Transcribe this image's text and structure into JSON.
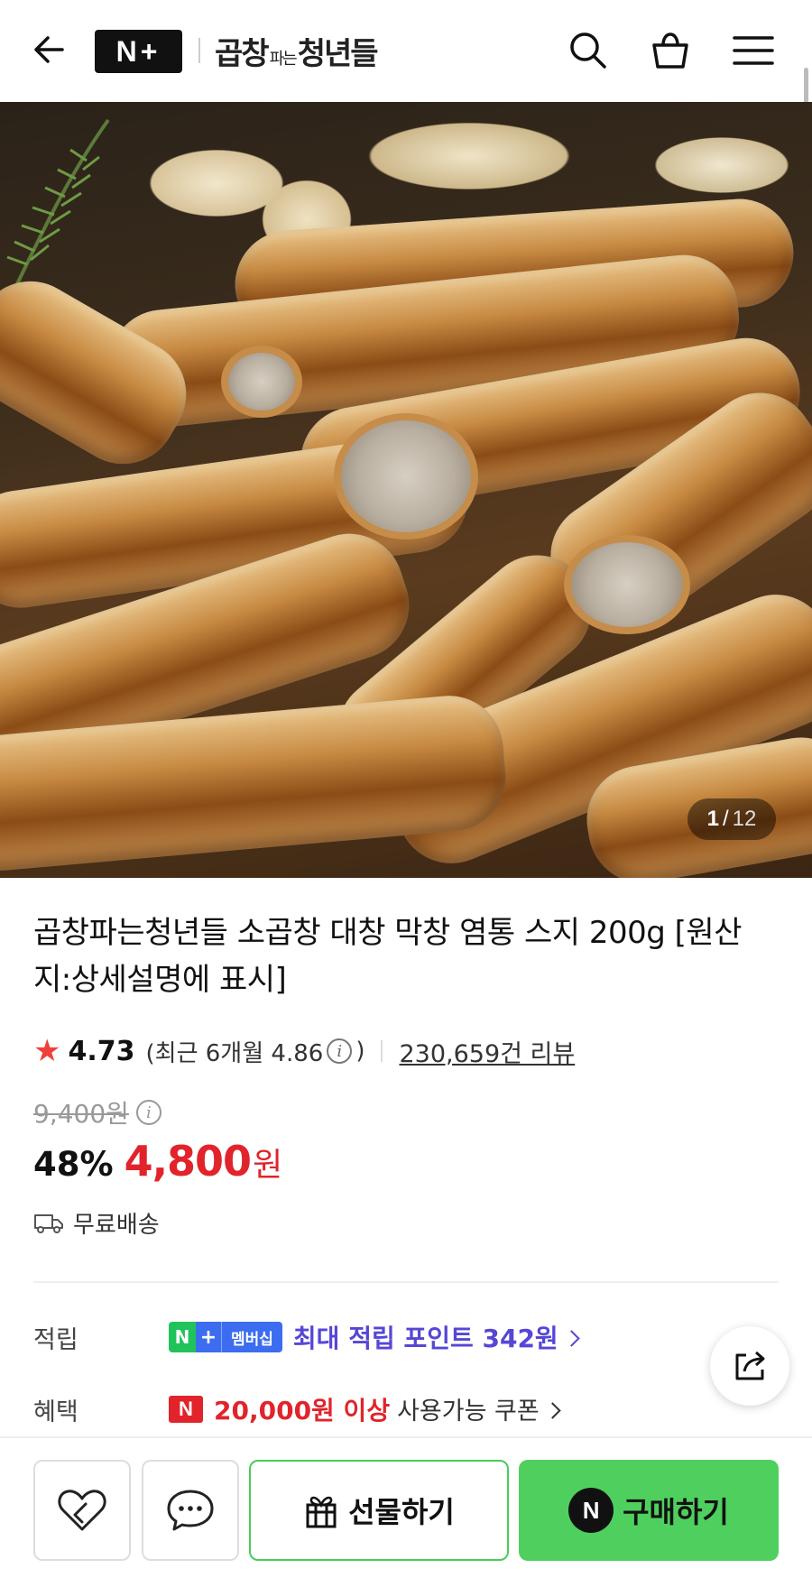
{
  "header": {
    "brand_badge": "N+",
    "store_name_part1": "곱창",
    "store_name_small": "파는",
    "store_name_part2": "청년들"
  },
  "gallery": {
    "current": "1",
    "separator": "/",
    "total": "12"
  },
  "product": {
    "title": "곱창파는청년들 소곱창 대창 막창 염통 스지 200g [원산지:상세설명에 표시]",
    "rating": "4.73",
    "recent_prefix": "(최근 6개월 4.86",
    "recent_suffix": ")",
    "review_count": "230,659건 리뷰",
    "original_price": "9,400원",
    "discount": "48%",
    "price": "4,800",
    "price_unit": "원",
    "delivery": "무료배송"
  },
  "benefits": {
    "points_label": "적립",
    "member_badge_n": "N",
    "member_badge_plus": "+",
    "member_badge_text": "멤버십",
    "points_text": "최대 적립 포인트 342원",
    "benefit_label": "혜택",
    "coupon_badge": "N",
    "coupon_highlight": "20,000원 이상",
    "coupon_rest": "사용가능 쿠폰"
  },
  "bottom_bar": {
    "gift_label": "선물하기",
    "buy_badge": "N",
    "buy_label": "구매하기"
  },
  "colors": {
    "accent_red": "#e1242b",
    "naver_green": "#4fd05e",
    "points_purple": "#5646d6",
    "membership_blue": "#3c6df0"
  },
  "icons": [
    "back-arrow-icon",
    "search-icon",
    "shopping-bag-icon",
    "menu-icon",
    "star-icon",
    "info-icon",
    "truck-icon",
    "chevron-right-icon",
    "share-icon",
    "heart-icon",
    "chat-icon",
    "gift-icon"
  ]
}
